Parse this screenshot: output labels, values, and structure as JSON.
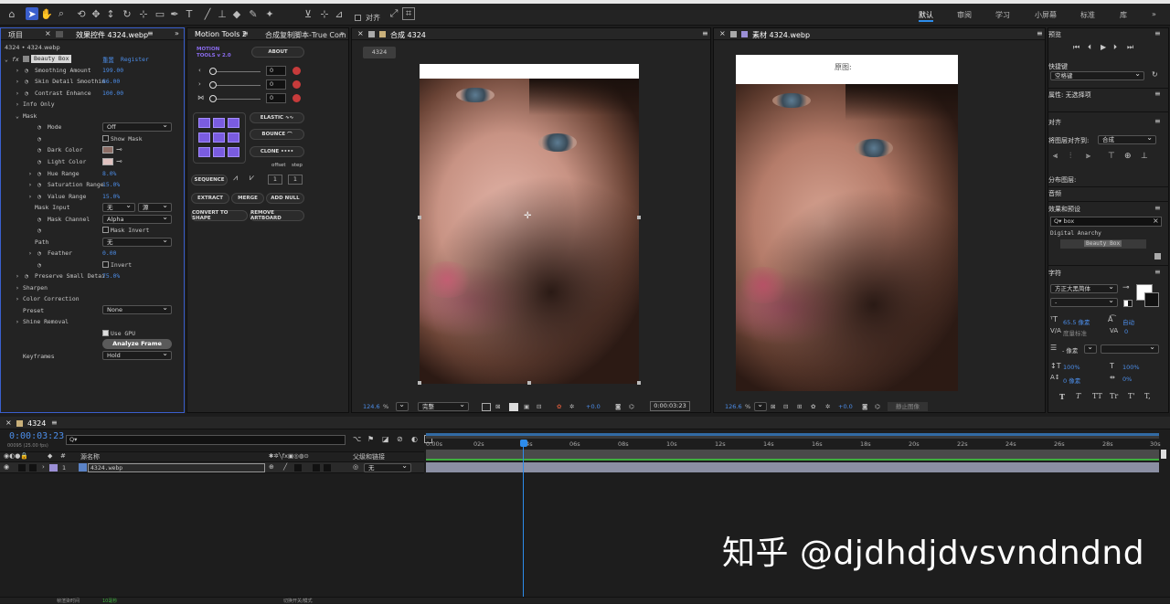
{
  "toolbar": {
    "align_label": "对齐",
    "workspaces": [
      "默认",
      "审阅",
      "学习",
      "小屏幕",
      "标准",
      "库"
    ],
    "active_workspace": "默认"
  },
  "project_panel": {
    "tab_project": "项目",
    "tab_effects": "效果控件 4324.webp",
    "breadcrumb": "4324 • 4324.webp",
    "effect_name": "Beauty Box",
    "reset": "重置",
    "register": "Register",
    "rows": [
      {
        "label": "Smoothing Amount",
        "value": "199.00"
      },
      {
        "label": "Skin Detail Smoothin",
        "value": "86.00"
      },
      {
        "label": "Contrast Enhance",
        "value": "100.00"
      },
      {
        "label": "Info Only",
        "value": ""
      },
      {
        "label": "Mask",
        "value": ""
      },
      {
        "label": "Mode",
        "value": "Off"
      },
      {
        "label": "Show Mask",
        "value": ""
      },
      {
        "label": "Dark Color",
        "value": ""
      },
      {
        "label": "Light Color",
        "value": ""
      },
      {
        "label": "Hue Range",
        "value": "8.0%"
      },
      {
        "label": "Saturation Range",
        "value": "15.0%"
      },
      {
        "label": "Value Range",
        "value": "15.0%"
      },
      {
        "label": "Mask Input",
        "value": "无"
      },
      {
        "label": "Mask Channel",
        "value": "Alpha"
      },
      {
        "label": "Mask Invert",
        "value": ""
      },
      {
        "label": "Path",
        "value": "无"
      },
      {
        "label": "Feather",
        "value": "0.00"
      },
      {
        "label": "Invert",
        "value": ""
      },
      {
        "label": "Preserve Small Detai",
        "value": "75.0%"
      },
      {
        "label": "Sharpen",
        "value": ""
      },
      {
        "label": "Color Correction",
        "value": ""
      },
      {
        "label": "Preset",
        "value": "None"
      },
      {
        "label": "Shine Removal",
        "value": ""
      },
      {
        "label": "Use GPU",
        "value": ""
      },
      {
        "label": "Analyze Frame",
        "value": ""
      },
      {
        "label": "Keyframes",
        "value": "Hold"
      }
    ],
    "mask_input_source": "源"
  },
  "motion_tools": {
    "tab": "Motion Tools 2",
    "tab2": "合成复制脚本-True Com",
    "logo_line1": "MOTION",
    "logo_line2": "TOOLS v 2.0",
    "about": "ABOUT",
    "fields": [
      "0",
      "0",
      "0"
    ],
    "elastic": "ELASTIC",
    "bounce": "BOUNCE",
    "clone": "CLONE",
    "offset": "offset",
    "step": "step",
    "sequence": "SEQUENCE",
    "seq_val1": "1",
    "seq_val2": "1",
    "extract": "EXTRACT",
    "merge": "MERGE",
    "add_null": "ADD NULL",
    "convert": "CONVERT TO SHAPE",
    "remove_artboard": "REMOVE ARTBOARD"
  },
  "comp_viewer": {
    "tab": "合成 4324",
    "chip": "4324",
    "zoom": "124.6",
    "quality": "完整",
    "exposure": "+0.0",
    "timecode": "0:00:03:23"
  },
  "footage_viewer": {
    "tab": "素材 4324.webp",
    "caption": "原图:",
    "zoom": "126.6",
    "exposure": "+0.0",
    "stop": "静止图像"
  },
  "right_panel": {
    "preview": "预览",
    "shortcut": "快捷键",
    "shortcut_value": "空格键",
    "properties": "属性: 无选择项",
    "align": "对齐",
    "align_to": "将图层对齐到:",
    "align_to_value": "合成",
    "distribute": "分布图层:",
    "audio": "音频",
    "effects_presets": "效果和预设",
    "search": "box",
    "category": "Digital Anarchy",
    "effect_item": "Beauty Box",
    "character": "字符",
    "font": "方正大黑简体",
    "font_style": "-",
    "font_size": "65.5 像素",
    "leading": "自动",
    "tracking_label": "度量标准",
    "tracking": "0",
    "stroke_label": "- 像素",
    "vscale": "100%",
    "hscale": "100%",
    "baseline": "0 像素",
    "tsume": "0%",
    "text_styles": [
      "T",
      "T",
      "TT",
      "Tr",
      "T'",
      "T,"
    ]
  },
  "timeline": {
    "tab": "4324",
    "timecode": "0:00:03:23",
    "frame_info": "00095 (25.00 fps)",
    "source_name_header": "源名称",
    "parent_header": "父级和链接",
    "layer_index": "1",
    "layer_name": "4324.webp",
    "parent_value": "无",
    "ruler": [
      "0:00s",
      "02s",
      "04s",
      "06s",
      "08s",
      "10s",
      "12s",
      "14s",
      "16s",
      "18s",
      "20s",
      "22s",
      "24s",
      "26s",
      "28s",
      "30s"
    ],
    "footer_left": "帧渲染时间",
    "footer_ms": "10毫秒",
    "footer_mid": "切换开关/模式"
  },
  "watermark": "知乎 @djdhdjdvsvndndnd",
  "colors": {
    "accent": "#2d8ceb",
    "motion_purple": "#7a5ce0",
    "layer_bar": "#8b8fa3",
    "playhead": "#2d8ceb"
  }
}
